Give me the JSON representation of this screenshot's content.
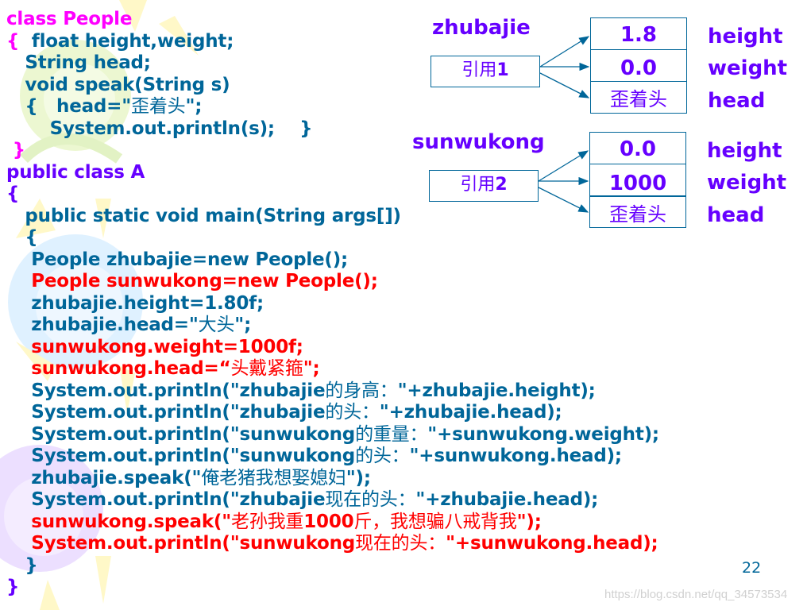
{
  "code_lines": [
    {
      "segs": [
        {
          "t": "class People",
          "c": "mag"
        }
      ]
    },
    {
      "segs": [
        {
          "t": "{  ",
          "c": "mag"
        },
        {
          "t": "float height,weight;",
          "c": "blue"
        }
      ]
    },
    {
      "segs": [
        {
          "t": "   String head;",
          "c": "blue"
        }
      ]
    },
    {
      "segs": [
        {
          "t": "   void speak(String s)",
          "c": "blue"
        }
      ]
    },
    {
      "segs": [
        {
          "t": "   {   head=\"",
          "c": "blue"
        },
        {
          "t": "歪着头",
          "c": "blue",
          "cj": true
        },
        {
          "t": "\";",
          "c": "blue"
        }
      ]
    },
    {
      "segs": [
        {
          "t": "       System.out.println(s);    }",
          "c": "blue"
        }
      ]
    },
    {
      "segs": [
        {
          "t": " }",
          "c": "mag"
        }
      ]
    },
    {
      "segs": [
        {
          "t": "public class A",
          "c": "pur"
        }
      ]
    },
    {
      "segs": [
        {
          "t": "{",
          "c": "pur"
        }
      ]
    },
    {
      "segs": [
        {
          "t": "   public static void main(String args[])",
          "c": "blue"
        }
      ]
    },
    {
      "segs": [
        {
          "t": "   {",
          "c": "blue"
        }
      ]
    },
    {
      "segs": [
        {
          "t": "    People zhubajie=new People();",
          "c": "blue"
        }
      ]
    },
    {
      "segs": [
        {
          "t": "    People sunwukong=new People();",
          "c": "red"
        }
      ]
    },
    {
      "segs": [
        {
          "t": "    zhubajie.height=1.80f;",
          "c": "blue"
        }
      ]
    },
    {
      "segs": [
        {
          "t": "    zhubajie.head=\"",
          "c": "blue"
        },
        {
          "t": "大头",
          "c": "blue",
          "cj": true
        },
        {
          "t": "\";",
          "c": "blue"
        }
      ]
    },
    {
      "segs": [
        {
          "t": "    sunwukong.weight=1000f;",
          "c": "red"
        }
      ]
    },
    {
      "segs": [
        {
          "t": "    sunwukong.head=“",
          "c": "red"
        },
        {
          "t": "头戴紧箍",
          "c": "red",
          "cj": true
        },
        {
          "t": "\";",
          "c": "red"
        }
      ]
    },
    {
      "segs": [
        {
          "t": "    System.out.println(\"zhubajie",
          "c": "blue"
        },
        {
          "t": "的身高：",
          "c": "blue",
          "cj": true
        },
        {
          "t": "\"+zhubajie.height);",
          "c": "blue"
        }
      ]
    },
    {
      "segs": [
        {
          "t": "    System.out.println(\"zhubajie",
          "c": "blue"
        },
        {
          "t": "的头：",
          "c": "blue",
          "cj": true
        },
        {
          "t": "\"+zhubajie.head);",
          "c": "blue"
        }
      ]
    },
    {
      "segs": [
        {
          "t": "    System.out.println(\"sunwukong",
          "c": "blue"
        },
        {
          "t": "的重量：",
          "c": "blue",
          "cj": true
        },
        {
          "t": "\"+sunwukong.weight);",
          "c": "blue"
        }
      ]
    },
    {
      "segs": [
        {
          "t": "    System.out.println(\"sunwukong",
          "c": "blue"
        },
        {
          "t": "的头：",
          "c": "blue",
          "cj": true
        },
        {
          "t": "\"+sunwukong.head);",
          "c": "blue"
        }
      ]
    },
    {
      "segs": [
        {
          "t": "    zhubajie.speak(\"",
          "c": "blue"
        },
        {
          "t": "俺老猪我想娶媳妇",
          "c": "blue",
          "cj": true
        },
        {
          "t": "\");",
          "c": "blue"
        }
      ]
    },
    {
      "segs": [
        {
          "t": "    System.out.println(\"zhubajie",
          "c": "blue"
        },
        {
          "t": "现在的头：",
          "c": "blue",
          "cj": true
        },
        {
          "t": "\"+zhubajie.head);",
          "c": "blue"
        }
      ]
    },
    {
      "segs": [
        {
          "t": "    sunwukong.speak(\"",
          "c": "red"
        },
        {
          "t": "老孙我重",
          "c": "red",
          "cj": true
        },
        {
          "t": "1000",
          "c": "red"
        },
        {
          "t": "斤，我想骗八戒背我",
          "c": "red",
          "cj": true
        },
        {
          "t": "\");",
          "c": "red"
        }
      ]
    },
    {
      "segs": [
        {
          "t": "    System.out.println(\"sunwukong",
          "c": "red"
        },
        {
          "t": "现在的头：",
          "c": "red",
          "cj": true
        },
        {
          "t": "\"+sunwukong.head);",
          "c": "red"
        }
      ]
    },
    {
      "segs": [
        {
          "t": "   }",
          "c": "blue"
        }
      ]
    },
    {
      "segs": [
        {
          "t": "}",
          "c": "pur"
        }
      ]
    }
  ],
  "diagram": {
    "objects": [
      {
        "name": "zhubajie",
        "ref_cjk": "引用",
        "ref_num": "1",
        "fields": [
          {
            "value": "1.8",
            "label": "height",
            "cjk": false
          },
          {
            "value": "0.0",
            "label": "weight",
            "cjk": false
          },
          {
            "value": "歪着头",
            "label": "head",
            "cjk": true
          }
        ]
      },
      {
        "name": "sunwukong",
        "ref_cjk": "引用",
        "ref_num": "2",
        "fields": [
          {
            "value": "0.0",
            "label": "height",
            "cjk": false
          },
          {
            "value": "1000",
            "label": "weight",
            "cjk": false
          },
          {
            "value": "歪着头",
            "label": "head",
            "cjk": true
          }
        ]
      }
    ]
  },
  "page_number": "22",
  "watermark": "https://blog.csdn.net/qq_34573534",
  "colors": {
    "keyword_blue": "#006699",
    "highlight_red": "#ff0000",
    "class_magenta": "#ff00ff",
    "class_purple": "#6600ff",
    "diagram_border": "#006699"
  }
}
